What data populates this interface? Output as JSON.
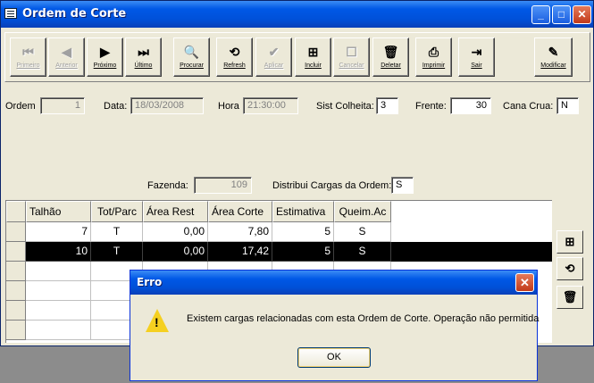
{
  "window": {
    "title": "Ordem de Corte"
  },
  "toolbar": {
    "buttons": [
      {
        "label": "Primeiro",
        "glyph": "⏮",
        "icon": "first-record-icon",
        "enabled": false
      },
      {
        "label": "Anterior",
        "glyph": "◀",
        "icon": "previous-record-icon",
        "enabled": false
      },
      {
        "label": "Próximo",
        "glyph": "▶",
        "icon": "next-record-icon",
        "enabled": true
      },
      {
        "label": "Último",
        "glyph": "⏭",
        "icon": "last-record-icon",
        "enabled": true
      },
      {
        "label": "Procurar",
        "glyph": "🔍",
        "icon": "search-icon",
        "enabled": true
      },
      {
        "label": "Refresh",
        "glyph": "⟲",
        "icon": "refresh-icon",
        "enabled": true
      },
      {
        "label": "Aplicar",
        "glyph": "✔",
        "icon": "apply-icon",
        "enabled": false
      },
      {
        "label": "Incluir",
        "glyph": "⊞",
        "icon": "insert-icon",
        "enabled": true
      },
      {
        "label": "Cancelar",
        "glyph": "☐",
        "icon": "cancel-icon",
        "enabled": false
      },
      {
        "label": "Deletar",
        "glyph": "🗑",
        "icon": "delete-icon",
        "enabled": true
      },
      {
        "label": "Imprimir",
        "glyph": "⎙",
        "icon": "print-icon",
        "enabled": true
      },
      {
        "label": "Sair",
        "glyph": "⇥",
        "icon": "exit-icon",
        "enabled": true
      },
      {
        "label": "Modificar",
        "glyph": "✎",
        "icon": "modify-icon",
        "enabled": true
      }
    ]
  },
  "form": {
    "ordem_label": "Ordem",
    "ordem_value": "1",
    "data_label": "Data:",
    "data_value": "18/03/2008",
    "hora_label": "Hora",
    "hora_value": "21:30:00",
    "sist_label": "Sist Colheita:",
    "sist_value": "3",
    "frente_label": "Frente:",
    "frente_value": "30",
    "cana_label": "Cana Crua:",
    "cana_value": "N",
    "fazenda_label": "Fazenda:",
    "fazenda_value": "109",
    "distribui_label": "Distribui Cargas da Ordem:",
    "distribui_value": "S"
  },
  "grid": {
    "columns": [
      "Talhão",
      "Tot/Parc",
      "Área Rest",
      "Área Corte",
      "Estimativa",
      "Queim.Ac"
    ],
    "rows": [
      [
        "7",
        "T",
        "0,00",
        "7,80",
        "5",
        "S"
      ],
      [
        "10",
        "T",
        "0,00",
        "17,42",
        "5",
        "S"
      ]
    ],
    "selected_row": 1
  },
  "side_buttons": [
    {
      "icon": "insert-icon",
      "glyph": "⊞"
    },
    {
      "icon": "refresh-icon",
      "glyph": "⟲"
    },
    {
      "icon": "delete-icon",
      "glyph": "🗑"
    }
  ],
  "dialog": {
    "title": "Erro",
    "message": "Existem cargas relacionadas com esta Ordem de Corte. Operação não permitida",
    "ok_label": "OK",
    "icon": "warning-icon"
  }
}
